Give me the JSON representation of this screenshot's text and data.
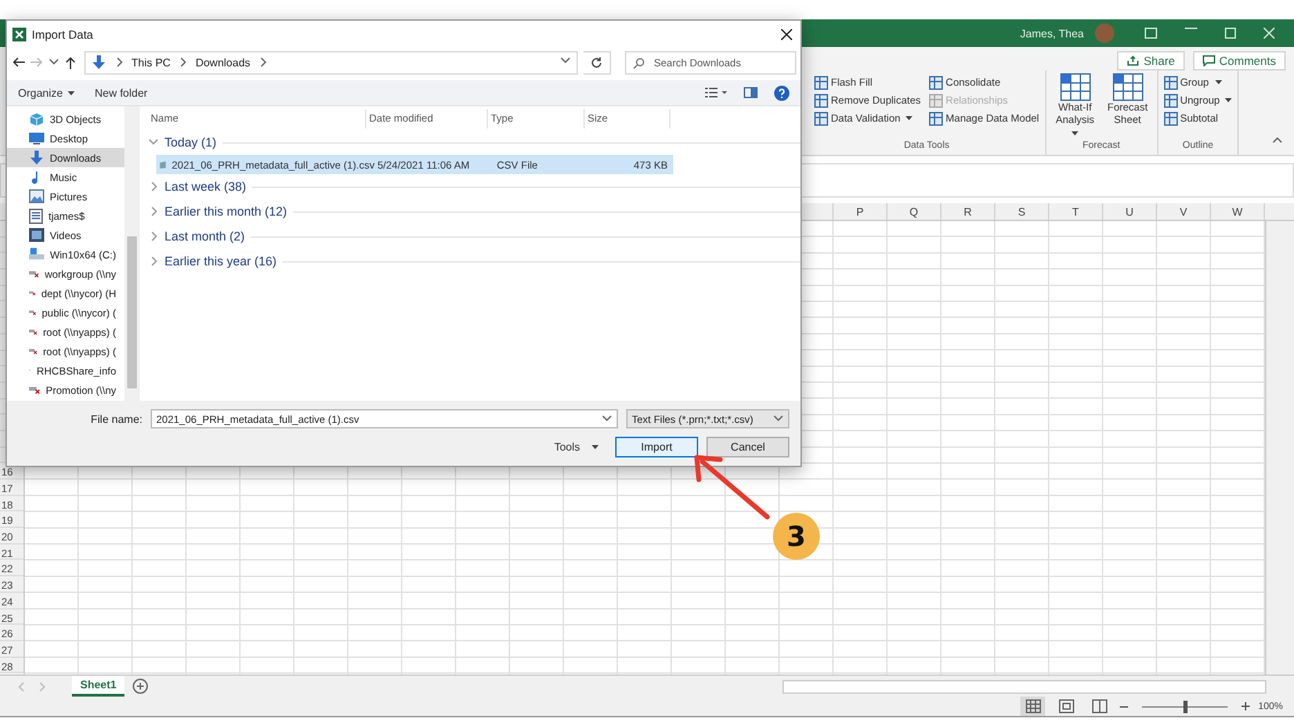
{
  "excel": {
    "user_name": "James, Thea",
    "share_button": "Share",
    "comments_button": "Comments",
    "ribbon_groups": [
      {
        "label": "Data Tools",
        "items": [
          {
            "label": "Flash Fill",
            "kind": "small",
            "dropdown": false,
            "disabled": false
          },
          {
            "label": "Remove Duplicates",
            "kind": "small",
            "dropdown": false,
            "disabled": false
          },
          {
            "label": "Data Validation",
            "kind": "small",
            "dropdown": true,
            "disabled": false
          },
          {
            "label": "Consolidate",
            "kind": "small",
            "dropdown": false,
            "disabled": false
          },
          {
            "label": "Relationships",
            "kind": "small",
            "dropdown": false,
            "disabled": true
          },
          {
            "label": "Manage Data Model",
            "kind": "small",
            "dropdown": false,
            "disabled": false
          }
        ]
      },
      {
        "label": "Forecast",
        "items": [
          {
            "label": "What-If Analysis",
            "kind": "large",
            "dropdown": true,
            "disabled": false
          },
          {
            "label": "Forecast Sheet",
            "kind": "large",
            "dropdown": false,
            "disabled": false
          }
        ]
      },
      {
        "label": "Outline",
        "items": [
          {
            "label": "Group",
            "kind": "small",
            "dropdown": true,
            "disabled": false
          },
          {
            "label": "Ungroup",
            "kind": "small",
            "dropdown": true,
            "disabled": false
          },
          {
            "label": "Subtotal",
            "kind": "small",
            "dropdown": false,
            "disabled": false
          }
        ]
      }
    ],
    "column_headers": [
      "P",
      "Q",
      "R",
      "S",
      "T",
      "U",
      "V",
      "W"
    ],
    "row_headers": [
      "16",
      "17",
      "18",
      "19",
      "20",
      "21",
      "22",
      "23",
      "24",
      "25",
      "26",
      "27",
      "28"
    ],
    "sheet_tabs": [
      {
        "label": "Sheet1",
        "selected": true
      }
    ],
    "views": [
      {
        "kind": "normal",
        "selected": true
      },
      {
        "kind": "page-layout",
        "selected": false
      },
      {
        "kind": "page-break",
        "selected": false
      }
    ],
    "zoom": {
      "level": 0.5,
      "reading": "100%"
    }
  },
  "dialog": {
    "title": "Import Data",
    "address": [
      "This PC",
      "Downloads"
    ],
    "search": {
      "placeholder": "Search Downloads"
    },
    "toolbar": {
      "organize": "Organize",
      "new_folder": "New folder"
    },
    "nav_items": [
      {
        "label": "3D Objects",
        "kind": "cube",
        "selected": false
      },
      {
        "label": "Desktop",
        "kind": "desktop",
        "selected": false
      },
      {
        "label": "Downloads",
        "kind": "download",
        "selected": true
      },
      {
        "label": "Music",
        "kind": "music",
        "selected": false
      },
      {
        "label": "Pictures",
        "kind": "pictures",
        "selected": false
      },
      {
        "label": "tjames$",
        "kind": "document",
        "selected": false
      },
      {
        "label": "Videos",
        "kind": "videos",
        "selected": false
      },
      {
        "label": "Win10x64 (C:)",
        "kind": "drive",
        "selected": false
      },
      {
        "label": "workgroup (\\\\ny",
        "kind": "network",
        "selected": false
      },
      {
        "label": "dept (\\\\nycor) (H",
        "kind": "network",
        "selected": false
      },
      {
        "label": "public (\\\\nycor) (",
        "kind": "network",
        "selected": false
      },
      {
        "label": "root (\\\\nyapps) (",
        "kind": "network",
        "selected": false
      },
      {
        "label": "root (\\\\nyapps) (",
        "kind": "network",
        "selected": false
      },
      {
        "label": "RHCBShare_info",
        "kind": "network",
        "selected": false
      },
      {
        "label": "Promotion (\\\\ny",
        "kind": "network",
        "selected": false
      }
    ],
    "columns": [
      "Name",
      "Date modified",
      "Type",
      "Size"
    ],
    "groups": [
      {
        "label": "Today (1)",
        "expanded": true,
        "files": [
          {
            "name": "2021_06_PRH_metadata_full_active (1).csv",
            "date": "5/24/2021 11:06 AM",
            "type": "CSV File",
            "size": "473 KB",
            "selected": true
          }
        ]
      },
      {
        "label": "Last week (38)",
        "expanded": false
      },
      {
        "label": "Earlier this month (12)",
        "expanded": false
      },
      {
        "label": "Last month (2)",
        "expanded": false
      },
      {
        "label": "Earlier this year (16)",
        "expanded": false
      }
    ],
    "file_name": {
      "label": "File name:",
      "value": "2021_06_PRH_metadata_full_active (1).csv"
    },
    "file_type": "Text Files (*.prn;*.txt;*.csv)",
    "tools": "Tools",
    "buttons": [
      {
        "label": "Import",
        "kind": "default"
      },
      {
        "label": "Cancel",
        "kind": "normal"
      }
    ]
  },
  "annotation": {
    "step": "3"
  }
}
